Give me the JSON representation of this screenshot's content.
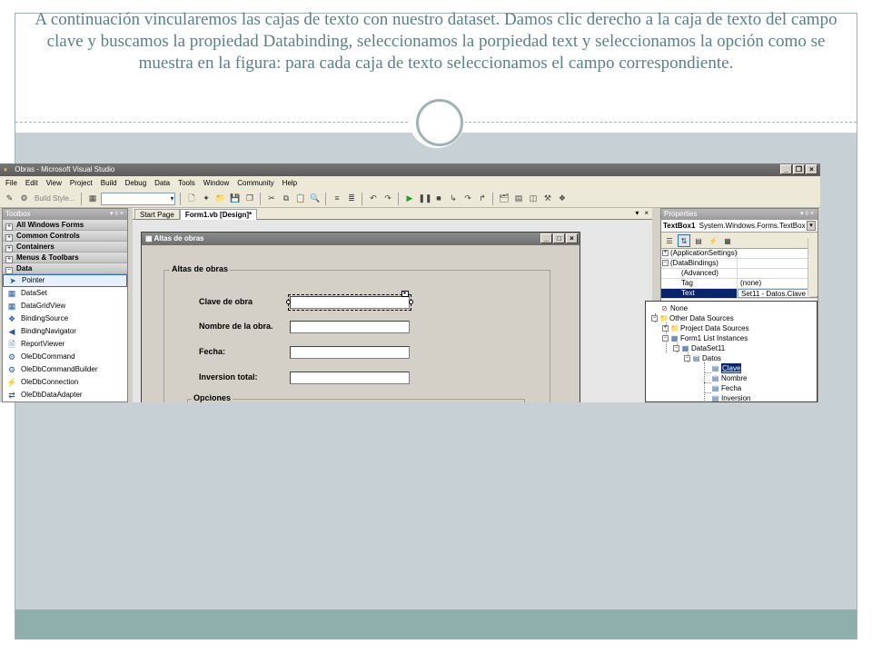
{
  "slide": {
    "caption": "A continuación vincularemos las cajas de texto con nuestro dataset. Damos clic derecho a la caja de texto del campo clave y buscamos la propiedad Databinding, seleccionamos la porpiedad text y seleccionamos la opción como se muestra en la figura: para cada caja de texto seleccionamos el campo correspondiente.",
    "colors": {
      "caption": "#5d7f86",
      "panel": "#c6d0d5",
      "band": "#8eafab"
    }
  },
  "vs": {
    "window_title": "Obras - Microsoft Visual Studio",
    "menu": [
      "File",
      "Edit",
      "View",
      "Project",
      "Build",
      "Debug",
      "Data",
      "Tools",
      "Window",
      "Community",
      "Help"
    ],
    "toolbar": {
      "build_style": "Build Style..."
    },
    "toolbox": {
      "title": "Toolbox",
      "groups": [
        "All Windows Forms",
        "Common Controls",
        "Containers",
        "Menus & Toolbars",
        "Data"
      ],
      "items": [
        "Pointer",
        "DataSet",
        "DataGridView",
        "BindingSource",
        "BindingNavigator",
        "ReportViewer",
        "OleDbCommand",
        "OleDbCommandBuilder",
        "OleDbConnection",
        "OleDbDataAdapter"
      ]
    },
    "tabs": [
      "Start Page",
      "Form1.vb [Design]*"
    ],
    "form": {
      "title": "Altas de obras",
      "group_title": "Altas de obras",
      "labels": [
        "Clave de obra",
        "Nombre de la obra.",
        "Fecha:",
        "Inversion total:"
      ],
      "group2_title": "Opciones"
    },
    "properties": {
      "title": "Properties",
      "object_name": "TextBox1",
      "object_type": "System.Windows.Forms.TextBox",
      "rows": [
        {
          "name": "(ApplicationSettings)",
          "value": ""
        },
        {
          "name": "(DataBindings)",
          "value": ""
        },
        {
          "name": "(Advanced)",
          "value": ""
        },
        {
          "name": "Tag",
          "value": "(none)"
        },
        {
          "name": "Text",
          "value": "Set11 - Datos.Clave"
        }
      ]
    },
    "binding_tree": [
      "None",
      "Other Data Sources",
      "Project Data Sources",
      "Form1 List Instances",
      "DataSet11",
      "Datos",
      "Clave",
      "Nombre",
      "Fecha",
      "Inversion"
    ]
  }
}
